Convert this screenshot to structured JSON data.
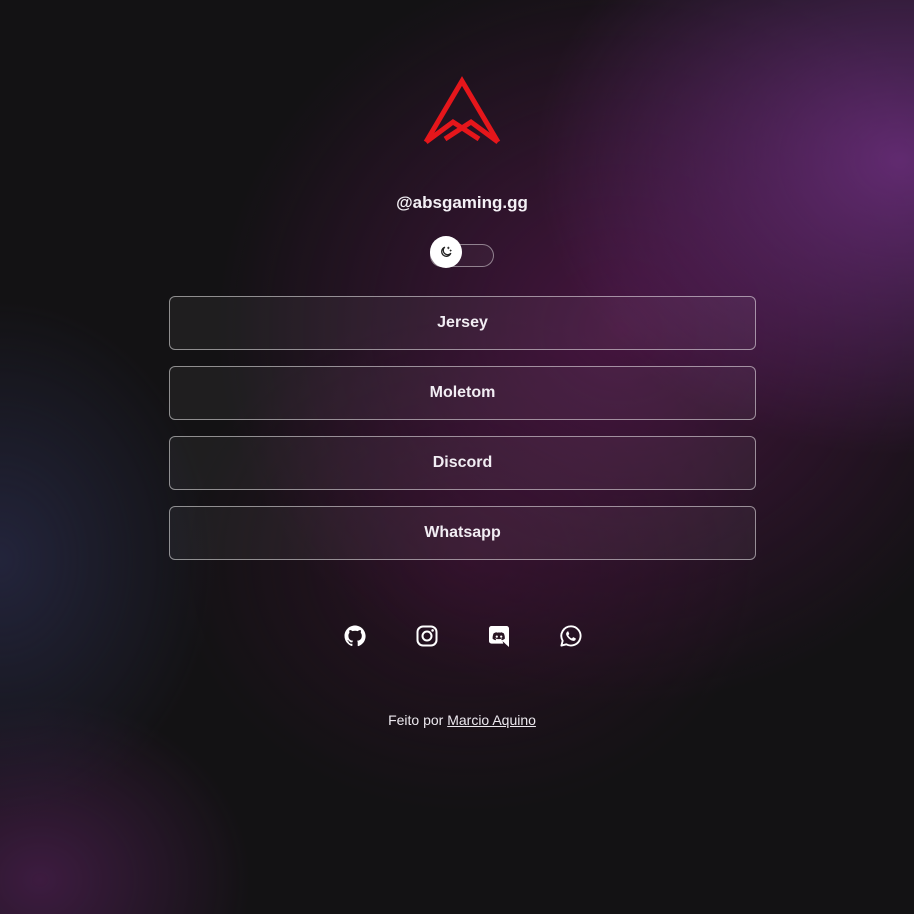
{
  "profile": {
    "handle": "@absgaming.gg",
    "logo_icon": "abs-logo",
    "logo_color": "#e5161b"
  },
  "theme_toggle": {
    "icon": "moon-icon",
    "state": "off"
  },
  "links": [
    {
      "label": "Jersey"
    },
    {
      "label": "Moletom"
    },
    {
      "label": "Discord"
    },
    {
      "label": "Whatsapp"
    }
  ],
  "socials": [
    {
      "icon": "github-icon"
    },
    {
      "icon": "instagram-icon"
    },
    {
      "icon": "discord-icon"
    },
    {
      "icon": "whatsapp-icon"
    }
  ],
  "footer": {
    "prefix": "Feito por",
    "author": "Marcio Aquino"
  }
}
